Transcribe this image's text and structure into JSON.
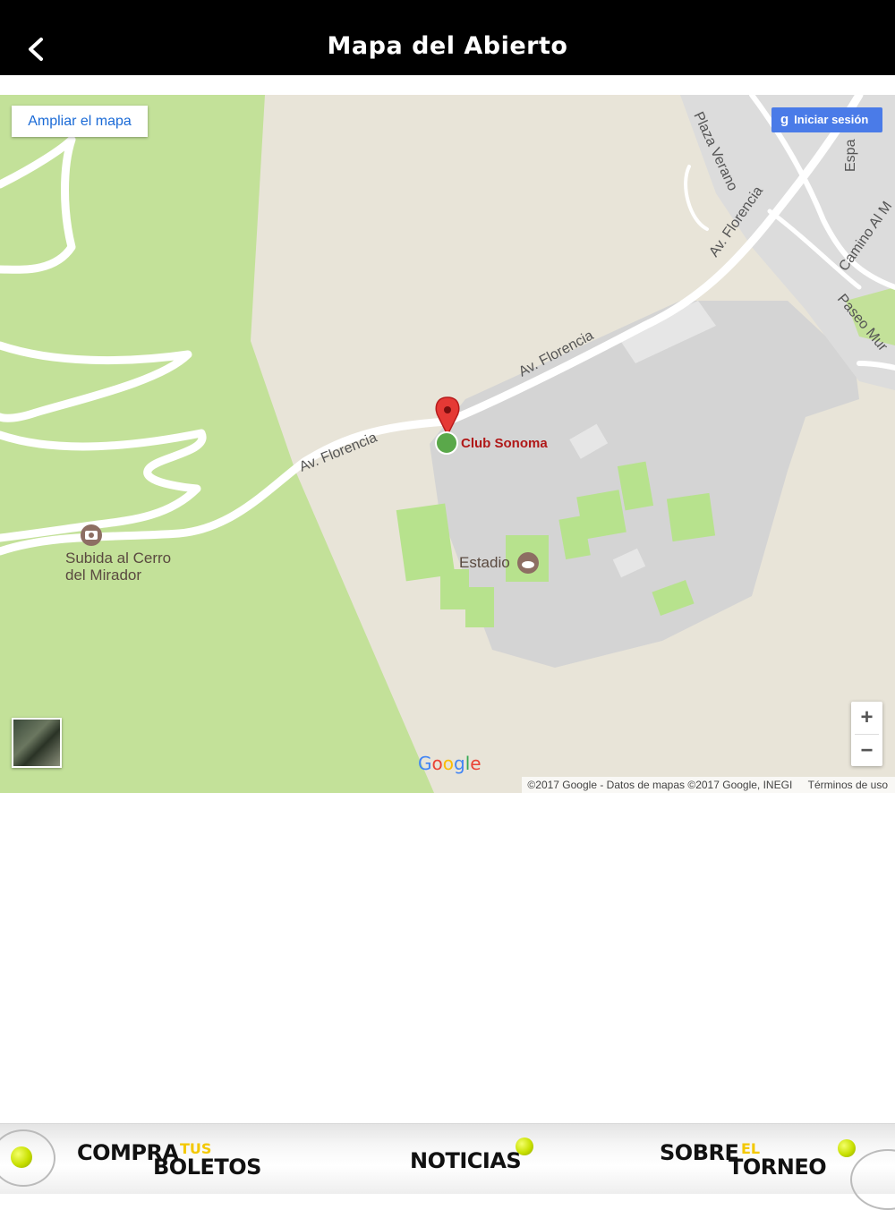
{
  "header": {
    "title": "Mapa del Abierto",
    "back_icon": "chevron-left-icon"
  },
  "map": {
    "expand_button": "Ampliar el mapa",
    "signin_button": "Iniciar sesión",
    "signin_icon": "google-plus-icon",
    "streets": {
      "florencia_1": "Av. Florencia",
      "florencia_2": "Av. Florencia",
      "florencia_3": "Av. Florencia",
      "plaza_verano": "Plaza Verano",
      "camino": "Camino Al M",
      "paseo": "Paseo Mur",
      "espa": "Espa"
    },
    "pois": {
      "club": "Club Sonoma",
      "estadio": "Estadio",
      "mirador_line1": "Subida al Cerro",
      "mirador_line2": "del Mirador"
    },
    "zoom_in": "+",
    "zoom_out": "−",
    "logo": "Google",
    "attribution": "©2017 Google - Datos de mapas ©2017 Google, INEGI",
    "terms": "Términos de uso",
    "colors": {
      "park": "#c3e199",
      "land": "#e8e4d8",
      "urban": "#d3d3d3",
      "field": "#b7e28d",
      "road": "#ffffff",
      "pin": "#e53935"
    }
  },
  "bottom_nav": [
    {
      "big": "COMPRA",
      "small": "TUS",
      "big2": "BOLETOS"
    },
    {
      "big": "NOTICIAS"
    },
    {
      "big": "SOBRE",
      "small": "EL",
      "big2": "TORNEO"
    }
  ]
}
